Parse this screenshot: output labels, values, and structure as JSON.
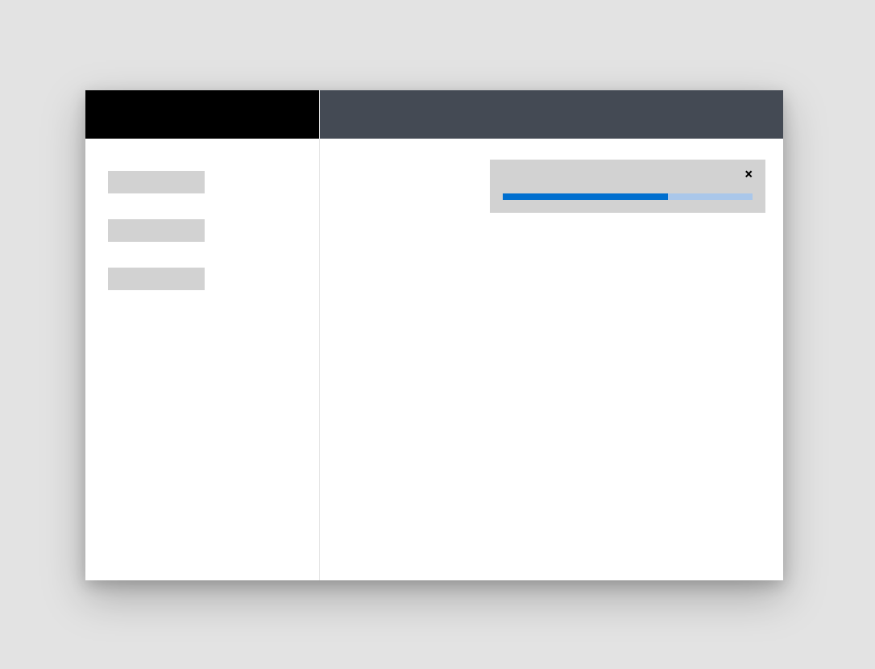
{
  "sidebar": {
    "items": [
      {
        "label": ""
      },
      {
        "label": ""
      },
      {
        "label": ""
      }
    ]
  },
  "toast": {
    "close_label": "×",
    "progress_percent": 66
  },
  "colors": {
    "sidebar_header": "#000000",
    "main_header": "#444a54",
    "placeholder": "#d2d2d2",
    "progress_track": "#aac7ea",
    "progress_fill": "#006fcf"
  }
}
